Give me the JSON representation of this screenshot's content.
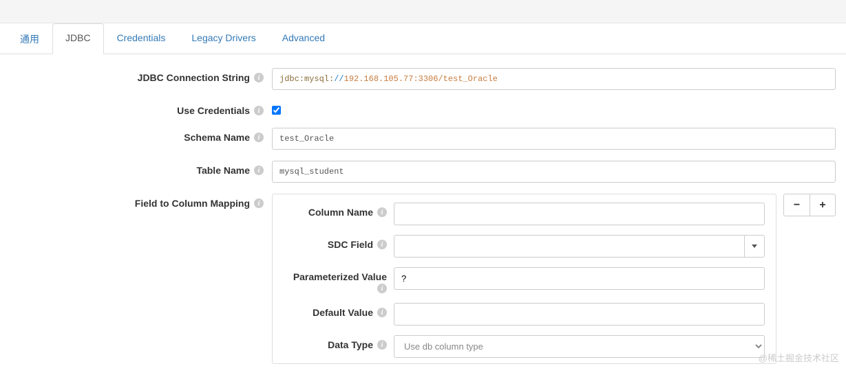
{
  "tabs": {
    "general": "通用",
    "jdbc": "JDBC",
    "credentials": "Credentials",
    "legacy": "Legacy Drivers",
    "advanced": "Advanced"
  },
  "form": {
    "connection_label": "JDBC Connection String",
    "connection_prefix": "jdbc:mysql:",
    "connection_slashes": "//",
    "connection_host": "192.168.105.77:3306",
    "connection_path": "/test_Oracle",
    "use_credentials_label": "Use Credentials",
    "use_credentials_checked": true,
    "schema_label": "Schema Name",
    "schema_value": "test_Oracle",
    "table_label": "Table Name",
    "table_value": "mysql_student",
    "mapping_label": "Field to Column Mapping"
  },
  "mapping": {
    "column_name_label": "Column Name",
    "column_name_value": "",
    "sdc_field_label": "SDC Field",
    "sdc_field_value": "",
    "param_value_label": "Parameterized Value",
    "param_value_value": "?",
    "default_value_label": "Default Value",
    "default_value_value": "",
    "data_type_label": "Data Type",
    "data_type_value": "Use db column type"
  },
  "buttons": {
    "minus": "−",
    "plus": "+"
  },
  "watermark": "@稀土掘金技术社区"
}
